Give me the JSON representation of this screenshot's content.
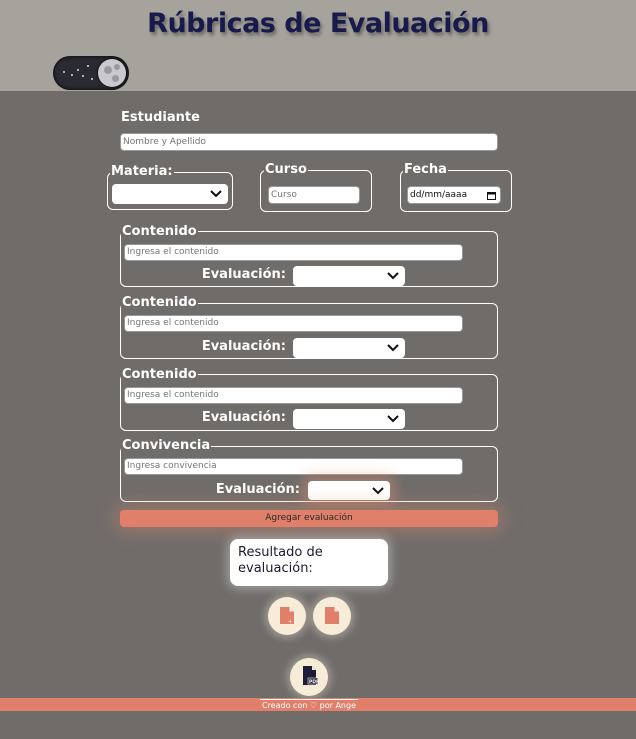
{
  "header": {
    "title": "Rúbricas de Evaluación"
  },
  "theme_toggle": {
    "icon": "moon-toggle-icon"
  },
  "student": {
    "label": "Estudiante",
    "placeholder": "Nombre y Apellido"
  },
  "materia": {
    "label": "Materia:"
  },
  "curso": {
    "label": "Curso",
    "placeholder": "Curso"
  },
  "fecha": {
    "label": "Fecha",
    "placeholder": "dd/mm/aaaa"
  },
  "sections": [
    {
      "legend": "Contenido",
      "placeholder": "Ingresa el contenido",
      "eval_label": "Evaluación:"
    },
    {
      "legend": "Contenido",
      "placeholder": "Ingresa el contenido",
      "eval_label": "Evaluación:"
    },
    {
      "legend": "Contenido",
      "placeholder": "Ingresa el contenido",
      "eval_label": "Evaluación:"
    },
    {
      "legend": "Convivencia",
      "placeholder": "Ingresa convivencia",
      "eval_label": "Evaluación:"
    }
  ],
  "add_button": {
    "label": "Agregar evaluación"
  },
  "result": {
    "text": "Resultado de evaluación:"
  },
  "footer": {
    "credit": "Creado con ♡ por Ange"
  },
  "colors": {
    "header_bg": "#a6a29c",
    "body_bg": "#6f6c6a",
    "title": "#171a4a",
    "accent": "#e07f6a",
    "icon_bg": "#f6ecd8"
  }
}
